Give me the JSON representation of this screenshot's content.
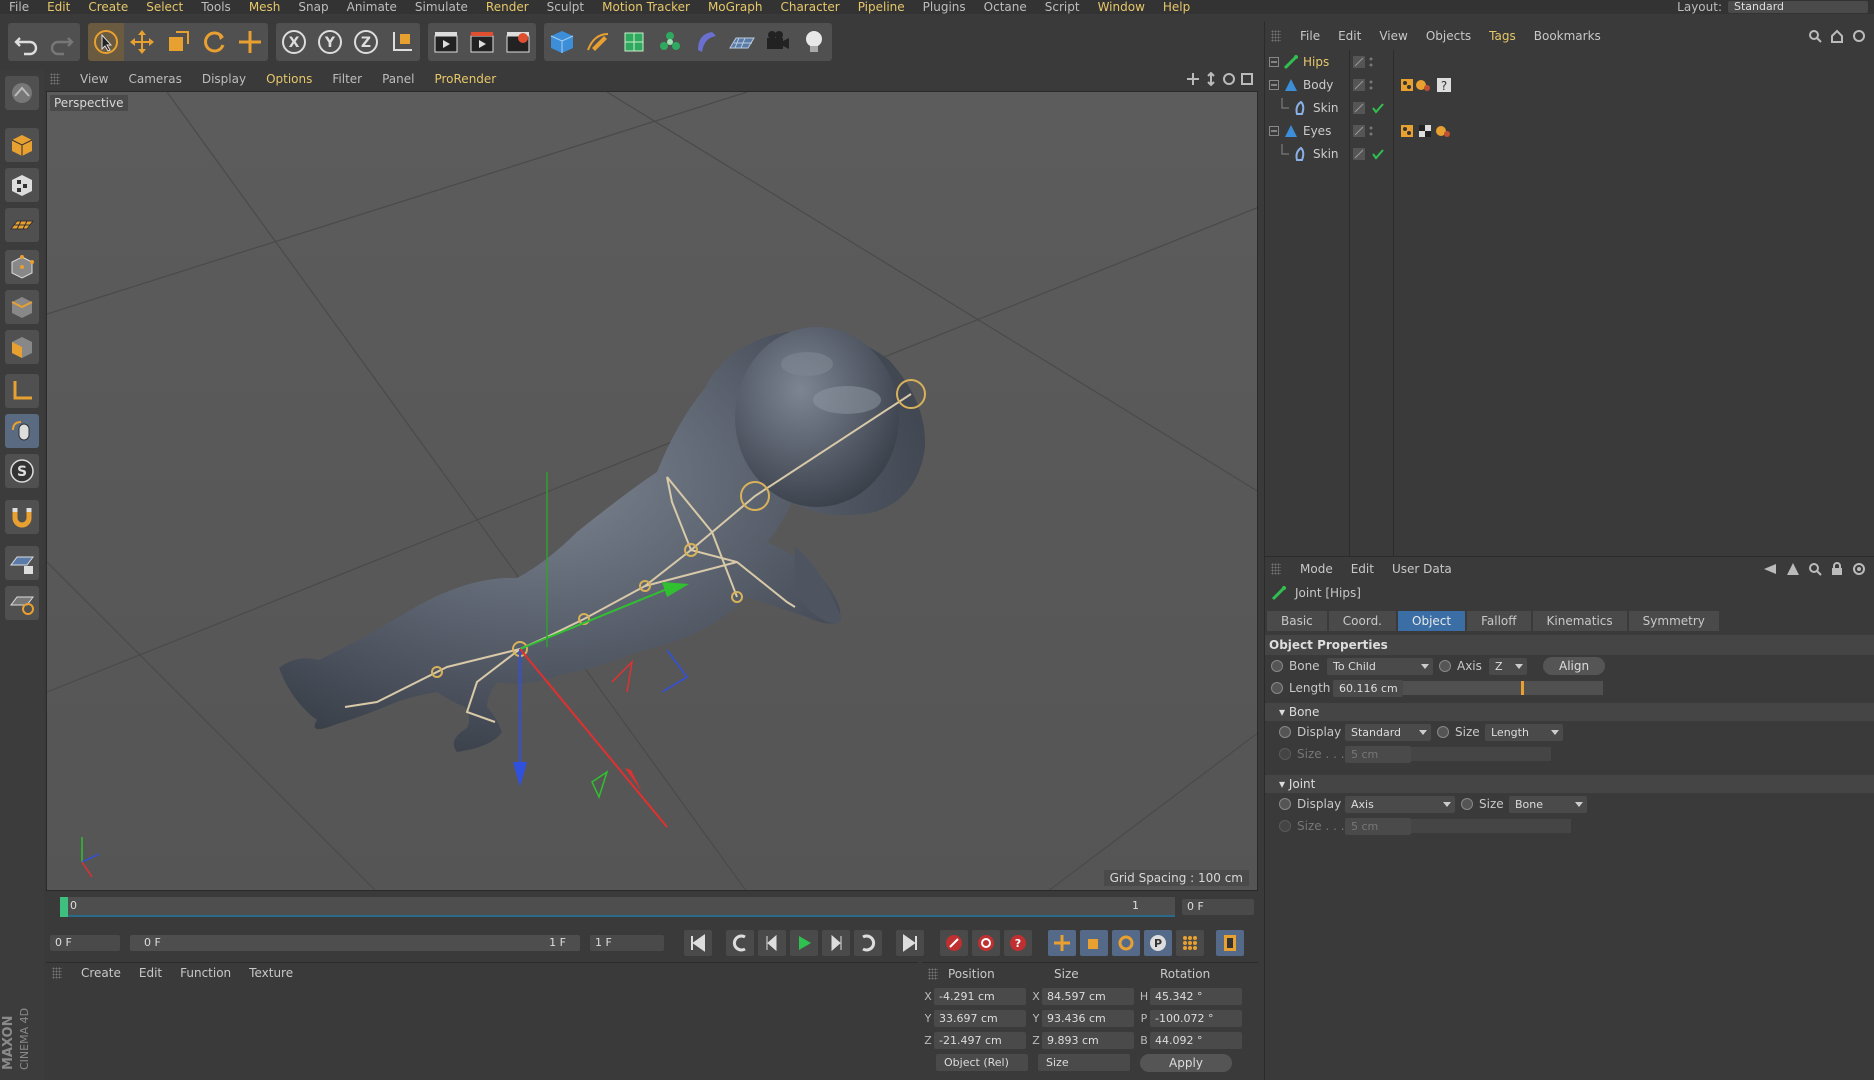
{
  "menu": [
    "File",
    "Edit",
    "Create",
    "Select",
    "Tools",
    "Mesh",
    "Snap",
    "Animate",
    "Simulate",
    "Render",
    "Sculpt",
    "Motion Tracker",
    "MoGraph",
    "Character",
    "Pipeline",
    "Plugins",
    "Octane",
    "Script",
    "Window",
    "Help"
  ],
  "menu_highlight": [
    "Edit",
    "Create",
    "Select",
    "Mesh",
    "Render",
    "Motion Tracker",
    "MoGraph",
    "Character",
    "Pipeline",
    "Window",
    "Help"
  ],
  "layout": {
    "label": "Layout:",
    "value": "Standard"
  },
  "toolbar": {
    "icons": [
      "undo-icon",
      "redo-icon",
      "live-select-icon",
      "move-icon",
      "scale-icon",
      "rotate-icon",
      "recent-tool-icon",
      "x-axis-icon",
      "y-axis-icon",
      "z-axis-icon",
      "world-coordinates-icon",
      "render-view-icon",
      "render-picture-viewer-icon",
      "edit-render-settings-icon",
      "cube-icon",
      "pen-icon",
      "subdivision-icon",
      "cloner-icon",
      "deformer-icon",
      "floor-icon",
      "camera-icon",
      "light-icon"
    ],
    "axis_labels": [
      "X",
      "Y",
      "Z"
    ]
  },
  "viewport": {
    "menu": [
      "View",
      "Cameras",
      "Display",
      "Options",
      "Filter",
      "Panel",
      "ProRender"
    ],
    "menu_highlight": [
      "Options",
      "ProRender"
    ],
    "label": "Perspective",
    "grid_spacing": "Grid Spacing : 100 cm"
  },
  "timeline": {
    "start": "0",
    "end": "1",
    "current_frame": "0 F"
  },
  "transport": {
    "start_field": "0 F",
    "range_start": "0 F",
    "range_end": "1 F",
    "end_field": "1 F"
  },
  "material_manager": {
    "menu": [
      "Create",
      "Edit",
      "Function",
      "Texture"
    ]
  },
  "coordinates": {
    "headers": [
      "Position",
      "Size",
      "Rotation"
    ],
    "rows": [
      {
        "pos_axis": "X",
        "pos": "-4.291 cm",
        "size_axis": "X",
        "size": "84.597 cm",
        "rot_axis": "H",
        "rot": "45.342 °"
      },
      {
        "pos_axis": "Y",
        "pos": "33.697 cm",
        "size_axis": "Y",
        "size": "93.436 cm",
        "rot_axis": "P",
        "rot": "-100.072 °"
      },
      {
        "pos_axis": "Z",
        "pos": "-21.497 cm",
        "size_axis": "Z",
        "size": "9.893 cm",
        "rot_axis": "B",
        "rot": "44.092 °"
      }
    ],
    "mode": "Object (Rel)",
    "size_mode": "Size",
    "apply": "Apply"
  },
  "object_manager": {
    "menu": [
      "File",
      "Edit",
      "View",
      "Objects",
      "Tags",
      "Bookmarks"
    ],
    "menu_highlight": [
      "Tags"
    ],
    "objects": [
      {
        "name": "Hips",
        "highlight": true,
        "icon": "joint-icon"
      },
      {
        "name": "Body",
        "highlight": false,
        "icon": "polygon-object-icon"
      },
      {
        "name": "Skin",
        "highlight": false,
        "icon": "skin-deformer-icon"
      },
      {
        "name": "Eyes",
        "highlight": false,
        "icon": "polygon-object-icon"
      },
      {
        "name": "Skin",
        "highlight": false,
        "icon": "skin-deformer-icon"
      }
    ]
  },
  "attribute_manager": {
    "menu": [
      "Mode",
      "Edit",
      "User Data"
    ],
    "title": "Joint [Hips]",
    "tabs": [
      "Basic",
      "Coord.",
      "Object",
      "Falloff",
      "Kinematics",
      "Symmetry"
    ],
    "active_tab": "Object",
    "section": "Object Properties",
    "bone_label": "Bone",
    "bone_value": "To Child",
    "axis_label": "Axis",
    "axis_value": "Z",
    "align": "Align",
    "length_label": "Length",
    "length_value": "60.116 cm",
    "bone_group": "Bone",
    "bone_display_label": "Display",
    "bone_display_value": "Standard",
    "bone_size_label": "Size",
    "bone_size_value": "Length",
    "bone_size_field_label": "Size . . .",
    "bone_size_field": "5 cm",
    "joint_group": "Joint",
    "joint_display_label": "Display",
    "joint_display_value": "Axis",
    "joint_size_label": "Size",
    "joint_size_value": "Bone",
    "joint_size_field_label": "Size . . .",
    "joint_size_field": "5 cm"
  },
  "branding": [
    "MAXON",
    "CINEMA 4D"
  ],
  "colors": {
    "accent": "#e6c76a",
    "active_tab": "#3a6ea5",
    "x_axis": "#e03030",
    "y_axis": "#30c030",
    "z_axis": "#3050e0",
    "timeline_cursor": "#3fbf7f"
  }
}
